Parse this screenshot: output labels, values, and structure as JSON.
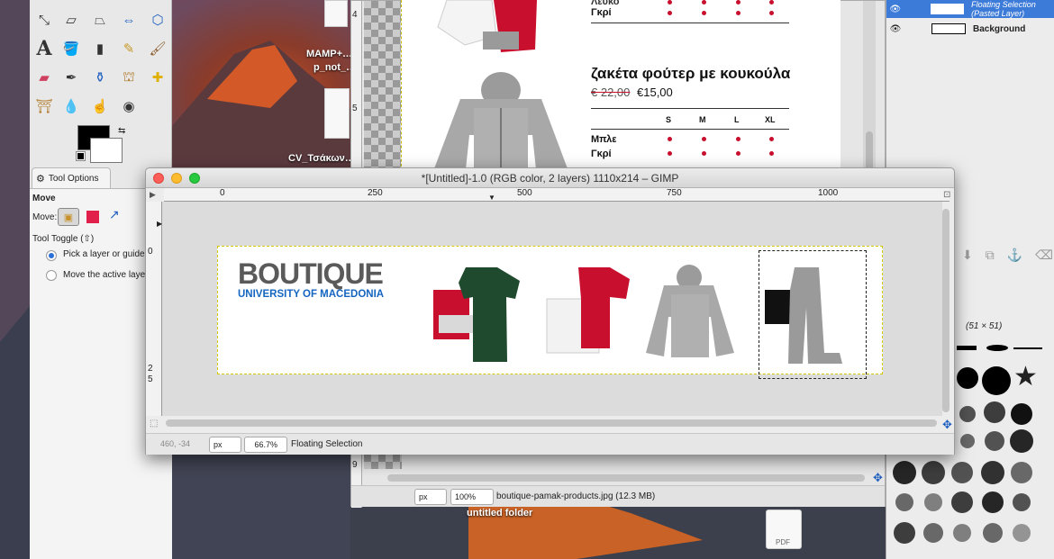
{
  "desktop": {
    "icon_labels": [
      "MAMP+…",
      "p_not_…",
      "CV_Τσάκων…",
      "untitled folder",
      "PDF"
    ]
  },
  "toolbox": {
    "tool_options_tab": "Tool Options",
    "tool_name": "Move",
    "move_label": "Move:",
    "tool_toggle": "Tool Toggle  (⇧)",
    "option_pick": "Pick a layer or guide",
    "option_move": "Move the active layer"
  },
  "image_window": {
    "product_title": "ζακέτα φούτερ με κουκούλα",
    "old_price": "€ 22,00",
    "new_price": "€15,00",
    "sizes": [
      "S",
      "M",
      "L",
      "XL"
    ],
    "colors_top": [
      "Λευκό",
      "Γκρί"
    ],
    "colors_bottom": [
      "Μπλε",
      "Γκρί"
    ],
    "ruler_left": [
      "4",
      "5",
      "9"
    ],
    "zoom_unit": "px",
    "zoom": "100%",
    "file_info": "boutique-pamak-products.jpg (12.3 MB)"
  },
  "layers": {
    "items": [
      {
        "name": "Floating Selection (Pasted Layer)"
      },
      {
        "name": "Background"
      }
    ],
    "brush_size": "(51 × 51)"
  },
  "gimp_window": {
    "title": "*[Untitled]-1.0 (RGB color, 2 layers) 1110x214 – GIMP",
    "ruler_h": [
      "0",
      "250",
      "500",
      "750",
      "1000"
    ],
    "ruler_v": [
      "0",
      "2",
      "5"
    ],
    "logo_main": "BOUTIQUE",
    "logo_sub": "UNIVERSITY OF MACEDONIA",
    "coords": "460, -34",
    "unit": "px",
    "zoom": "66.7%",
    "status": "Floating Selection"
  },
  "colors": {
    "accent": "#2a6fd6",
    "logo_grey": "#5a5a5a",
    "logo_blue": "#1565c0",
    "dot_red": "#c8102e",
    "selection_yellow": "#d6c800"
  }
}
